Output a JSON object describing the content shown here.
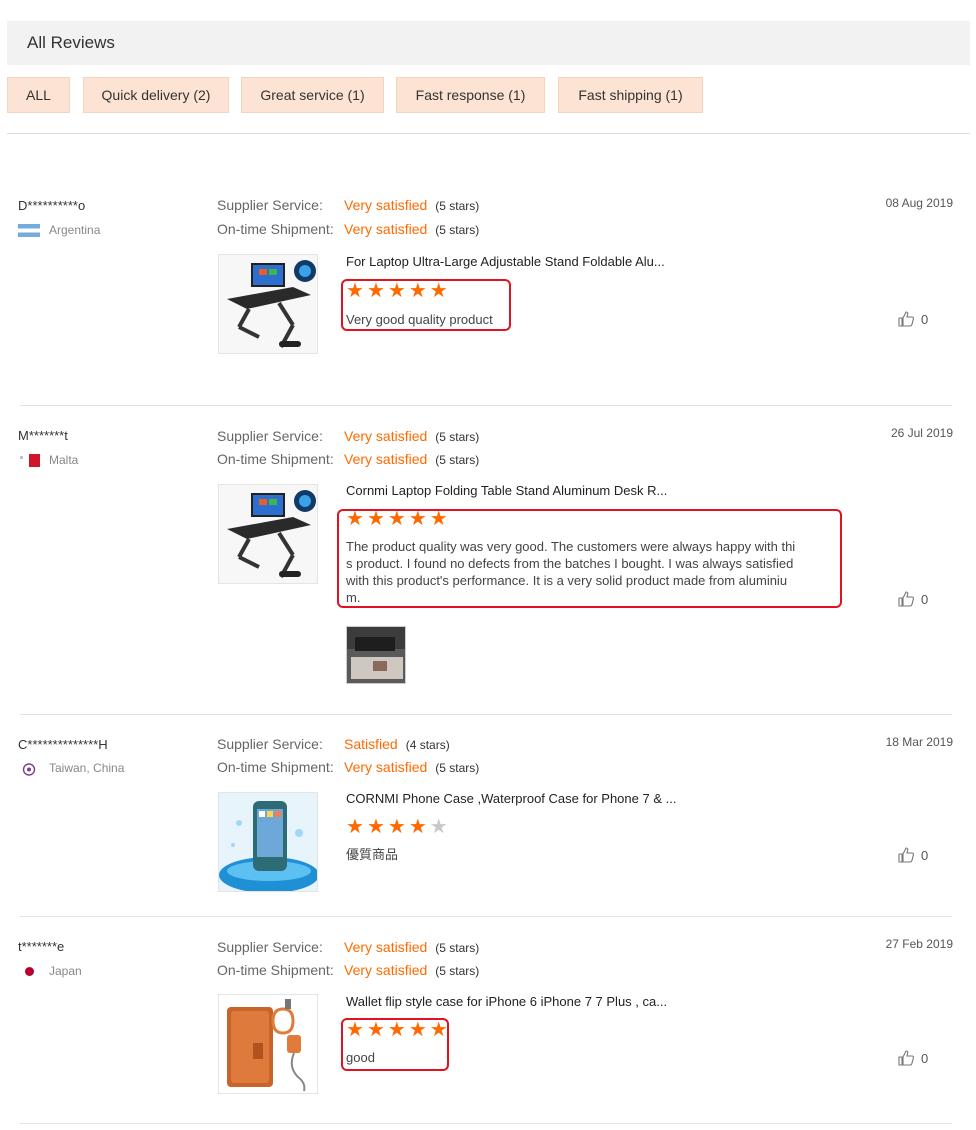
{
  "header": {
    "title": "All Reviews"
  },
  "filters": [
    {
      "label": "ALL"
    },
    {
      "label": "Quick delivery (2)"
    },
    {
      "label": "Great service (1)"
    },
    {
      "label": "Fast response (1)"
    },
    {
      "label": "Fast shipping (1)"
    }
  ],
  "colors": {
    "accent": "#ff6a00",
    "chip_bg": "#fde3d3",
    "highlight": "#e0141e"
  },
  "service_labels": {
    "supplier": "Supplier Service:",
    "shipment": "On-time Shipment:"
  },
  "reviews": [
    {
      "user": "D**********o",
      "country": "Argentina",
      "flag_icon": "argentina-flag-icon",
      "supplier_service": "Very satisfied",
      "supplier_stars": "(5 stars)",
      "shipment": "Very satisfied",
      "shipment_stars": "(5 stars)",
      "date": "08 Aug 2019",
      "product_title": "For Laptop Ultra-Large Adjustable Stand Foldable Alu...",
      "rating": 5,
      "text": "Very good quality product",
      "likes": "0"
    },
    {
      "user": "M*******t",
      "country": "Malta",
      "flag_icon": "malta-flag-icon",
      "supplier_service": "Very satisfied",
      "supplier_stars": "(5 stars)",
      "shipment": "Very satisfied",
      "shipment_stars": "(5 stars)",
      "date": "26 Jul 2019",
      "product_title": "Cornmi Laptop Folding Table Stand Aluminum Desk R...",
      "rating": 5,
      "text_lines": [
        "The product quality was very good. The customers were always happy with thi",
        "s product. I found no defects from the batches I bought. I was always satisfied",
        "with this product's performance. It is a very solid product made from aluminiu",
        "m."
      ],
      "likes": "0"
    },
    {
      "user": "C**************H",
      "country": "Taiwan, China",
      "flag_icon": "taiwan-flag-icon",
      "supplier_service": "Satisfied",
      "supplier_stars": "(4 stars)",
      "shipment": "Very satisfied",
      "shipment_stars": "(5 stars)",
      "date": "18 Mar 2019",
      "product_title": "CORNMI Phone Case ,Waterproof Case for Phone 7 & ...",
      "rating": 4,
      "text": "優質商品",
      "likes": "0"
    },
    {
      "user": "t*******e",
      "country": "Japan",
      "flag_icon": "japan-flag-icon",
      "supplier_service": "Very satisfied",
      "supplier_stars": "(5 stars)",
      "shipment": "Very satisfied",
      "shipment_stars": "(5 stars)",
      "date": "27 Feb 2019",
      "product_title": "Wallet flip style case for iPhone 6 iPhone 7 7 Plus , ca...",
      "rating": 5,
      "text": "good",
      "likes": "0"
    }
  ]
}
